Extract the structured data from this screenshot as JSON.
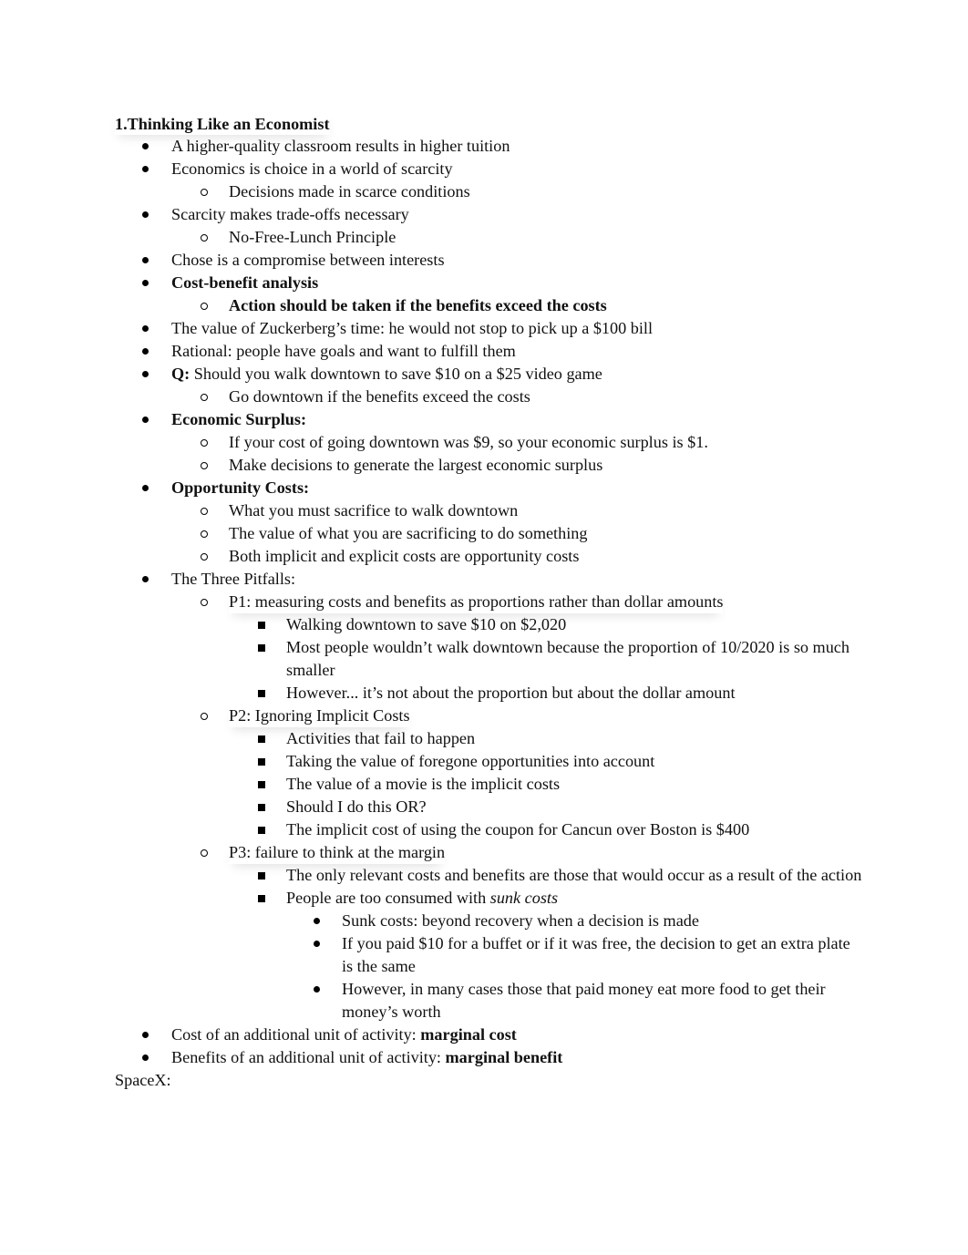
{
  "document": {
    "title": "1.Thinking Like an Economist",
    "items": [
      {
        "level": 1,
        "text": "A higher-quality classroom results in higher tuition"
      },
      {
        "level": 1,
        "text": "Economics is choice in a world of scarcity"
      },
      {
        "level": 2,
        "text": "Decisions made in scarce conditions"
      },
      {
        "level": 1,
        "text": "Scarcity makes trade-offs necessary"
      },
      {
        "level": 2,
        "text": "No-Free-Lunch Principle"
      },
      {
        "level": 1,
        "text": "Chose is a compromise between interests"
      },
      {
        "level": 1,
        "text": "Cost-benefit analysis"
      },
      {
        "level": 2,
        "text": "Action should be taken if the benefits exceed the costs"
      },
      {
        "level": 1,
        "text": "The value of Zuckerberg’s time: he would not stop to pick up a $100 bill"
      },
      {
        "level": 1,
        "text": "Rational: people have goals and want to fulfill them"
      },
      {
        "level": 1,
        "bold_prefix": "Q:",
        "text": " Should you walk downtown to save $10 on a $25 video game"
      },
      {
        "level": 2,
        "text": "Go downtown if the benefits exceed the costs"
      },
      {
        "level": 1,
        "text": "Economic Surplus:"
      },
      {
        "level": 2,
        "text": "If your cost of going downtown was $9, so your economic surplus is $1."
      },
      {
        "level": 2,
        "text": "Make decisions to generate the largest economic surplus"
      },
      {
        "level": 1,
        "text": "Opportunity Costs:"
      },
      {
        "level": 2,
        "text": "What you must sacrifice to walk downtown"
      },
      {
        "level": 2,
        "text": "The value of what you are sacrificing to do something"
      },
      {
        "level": 2,
        "text": "Both implicit and explicit costs are opportunity costs"
      },
      {
        "level": 1,
        "text": "The Three Pitfalls:"
      },
      {
        "level": 2,
        "text": "P1: measuring costs and benefits as proportions rather than dollar amounts"
      },
      {
        "level": 3,
        "text": "Walking downtown to save $10 on $2,020"
      },
      {
        "level": 3,
        "text": "Most people wouldn’t walk downtown because the proportion of 10/2020 is so much smaller"
      },
      {
        "level": 3,
        "text": "However... it’s not about the proportion but about the dollar amount"
      },
      {
        "level": 2,
        "text": "P2: Ignoring Implicit Costs"
      },
      {
        "level": 3,
        "text": "Activities that fail to happen"
      },
      {
        "level": 3,
        "text": "Taking the value of foregone opportunities into account"
      },
      {
        "level": 3,
        "text": "The value of a movie is the implicit costs"
      },
      {
        "level": 3,
        "text": "Should I do this OR?"
      },
      {
        "level": 3,
        "text": "The implicit cost of using the coupon for Cancun over Boston is $400"
      },
      {
        "level": 2,
        "text": "P3: failure to think at the margin"
      },
      {
        "level": 3,
        "text": "The only relevant costs and benefits are those that would occur as a result of the action"
      },
      {
        "level": 3,
        "text": "People are too consumed with ",
        "italic_suffix": "sunk costs"
      },
      {
        "level": 4,
        "text": "Sunk costs: beyond recovery when a decision is made"
      },
      {
        "level": 4,
        "text": "If you paid $10 for a buffet or if it was free, the decision to get an extra plate is the same"
      },
      {
        "level": 4,
        "text": "However, in many cases those that paid money eat more food to get their money’s worth"
      },
      {
        "level": 1,
        "text": "Cost of an additional unit of activity: ",
        "bold_suffix": "marginal cost"
      },
      {
        "level": 1,
        "text": "Benefits of an additional unit of activity: ",
        "bold_suffix": "marginal benefit"
      }
    ],
    "footer": "SpaceX:"
  }
}
